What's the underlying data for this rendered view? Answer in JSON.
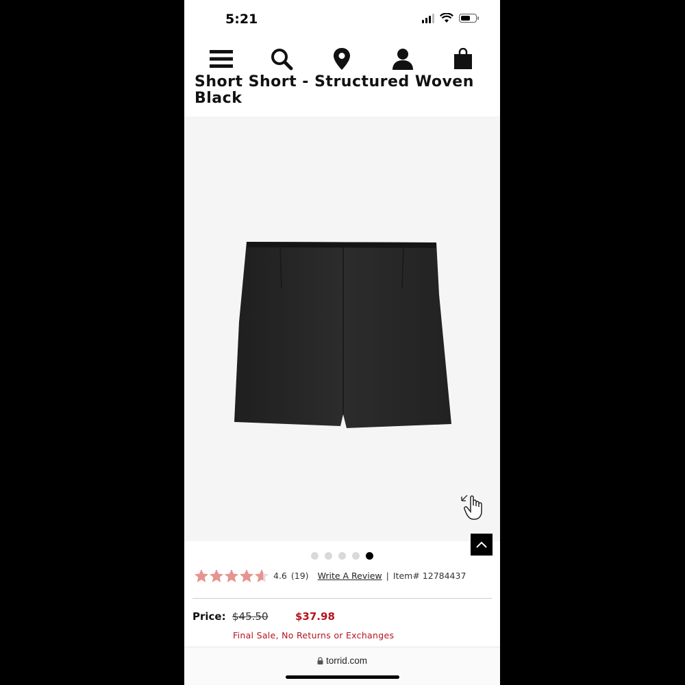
{
  "status": {
    "time": "5:21"
  },
  "nav": {
    "icons": [
      "menu-icon",
      "search-icon",
      "location-pin-icon",
      "account-icon",
      "shopping-bag-icon"
    ]
  },
  "product": {
    "title": "Short Short - Structured Woven Black",
    "image_alt": "black structured woven shorts",
    "carousel": {
      "total": 5,
      "active_index": 4
    }
  },
  "reviews": {
    "rating": "4.6",
    "rating_value": 4.6,
    "count": "(19)",
    "write_review": "Write A Review",
    "separator": "|",
    "item_label": "Item# 12784437"
  },
  "price": {
    "label": "Price:",
    "original": "$45.50",
    "sale": "$37.98",
    "note": "Final Sale, No Returns or Exchanges"
  },
  "browser": {
    "url": "torrid.com"
  },
  "colors": {
    "sale": "#b5121b",
    "star": "#e8938f"
  }
}
